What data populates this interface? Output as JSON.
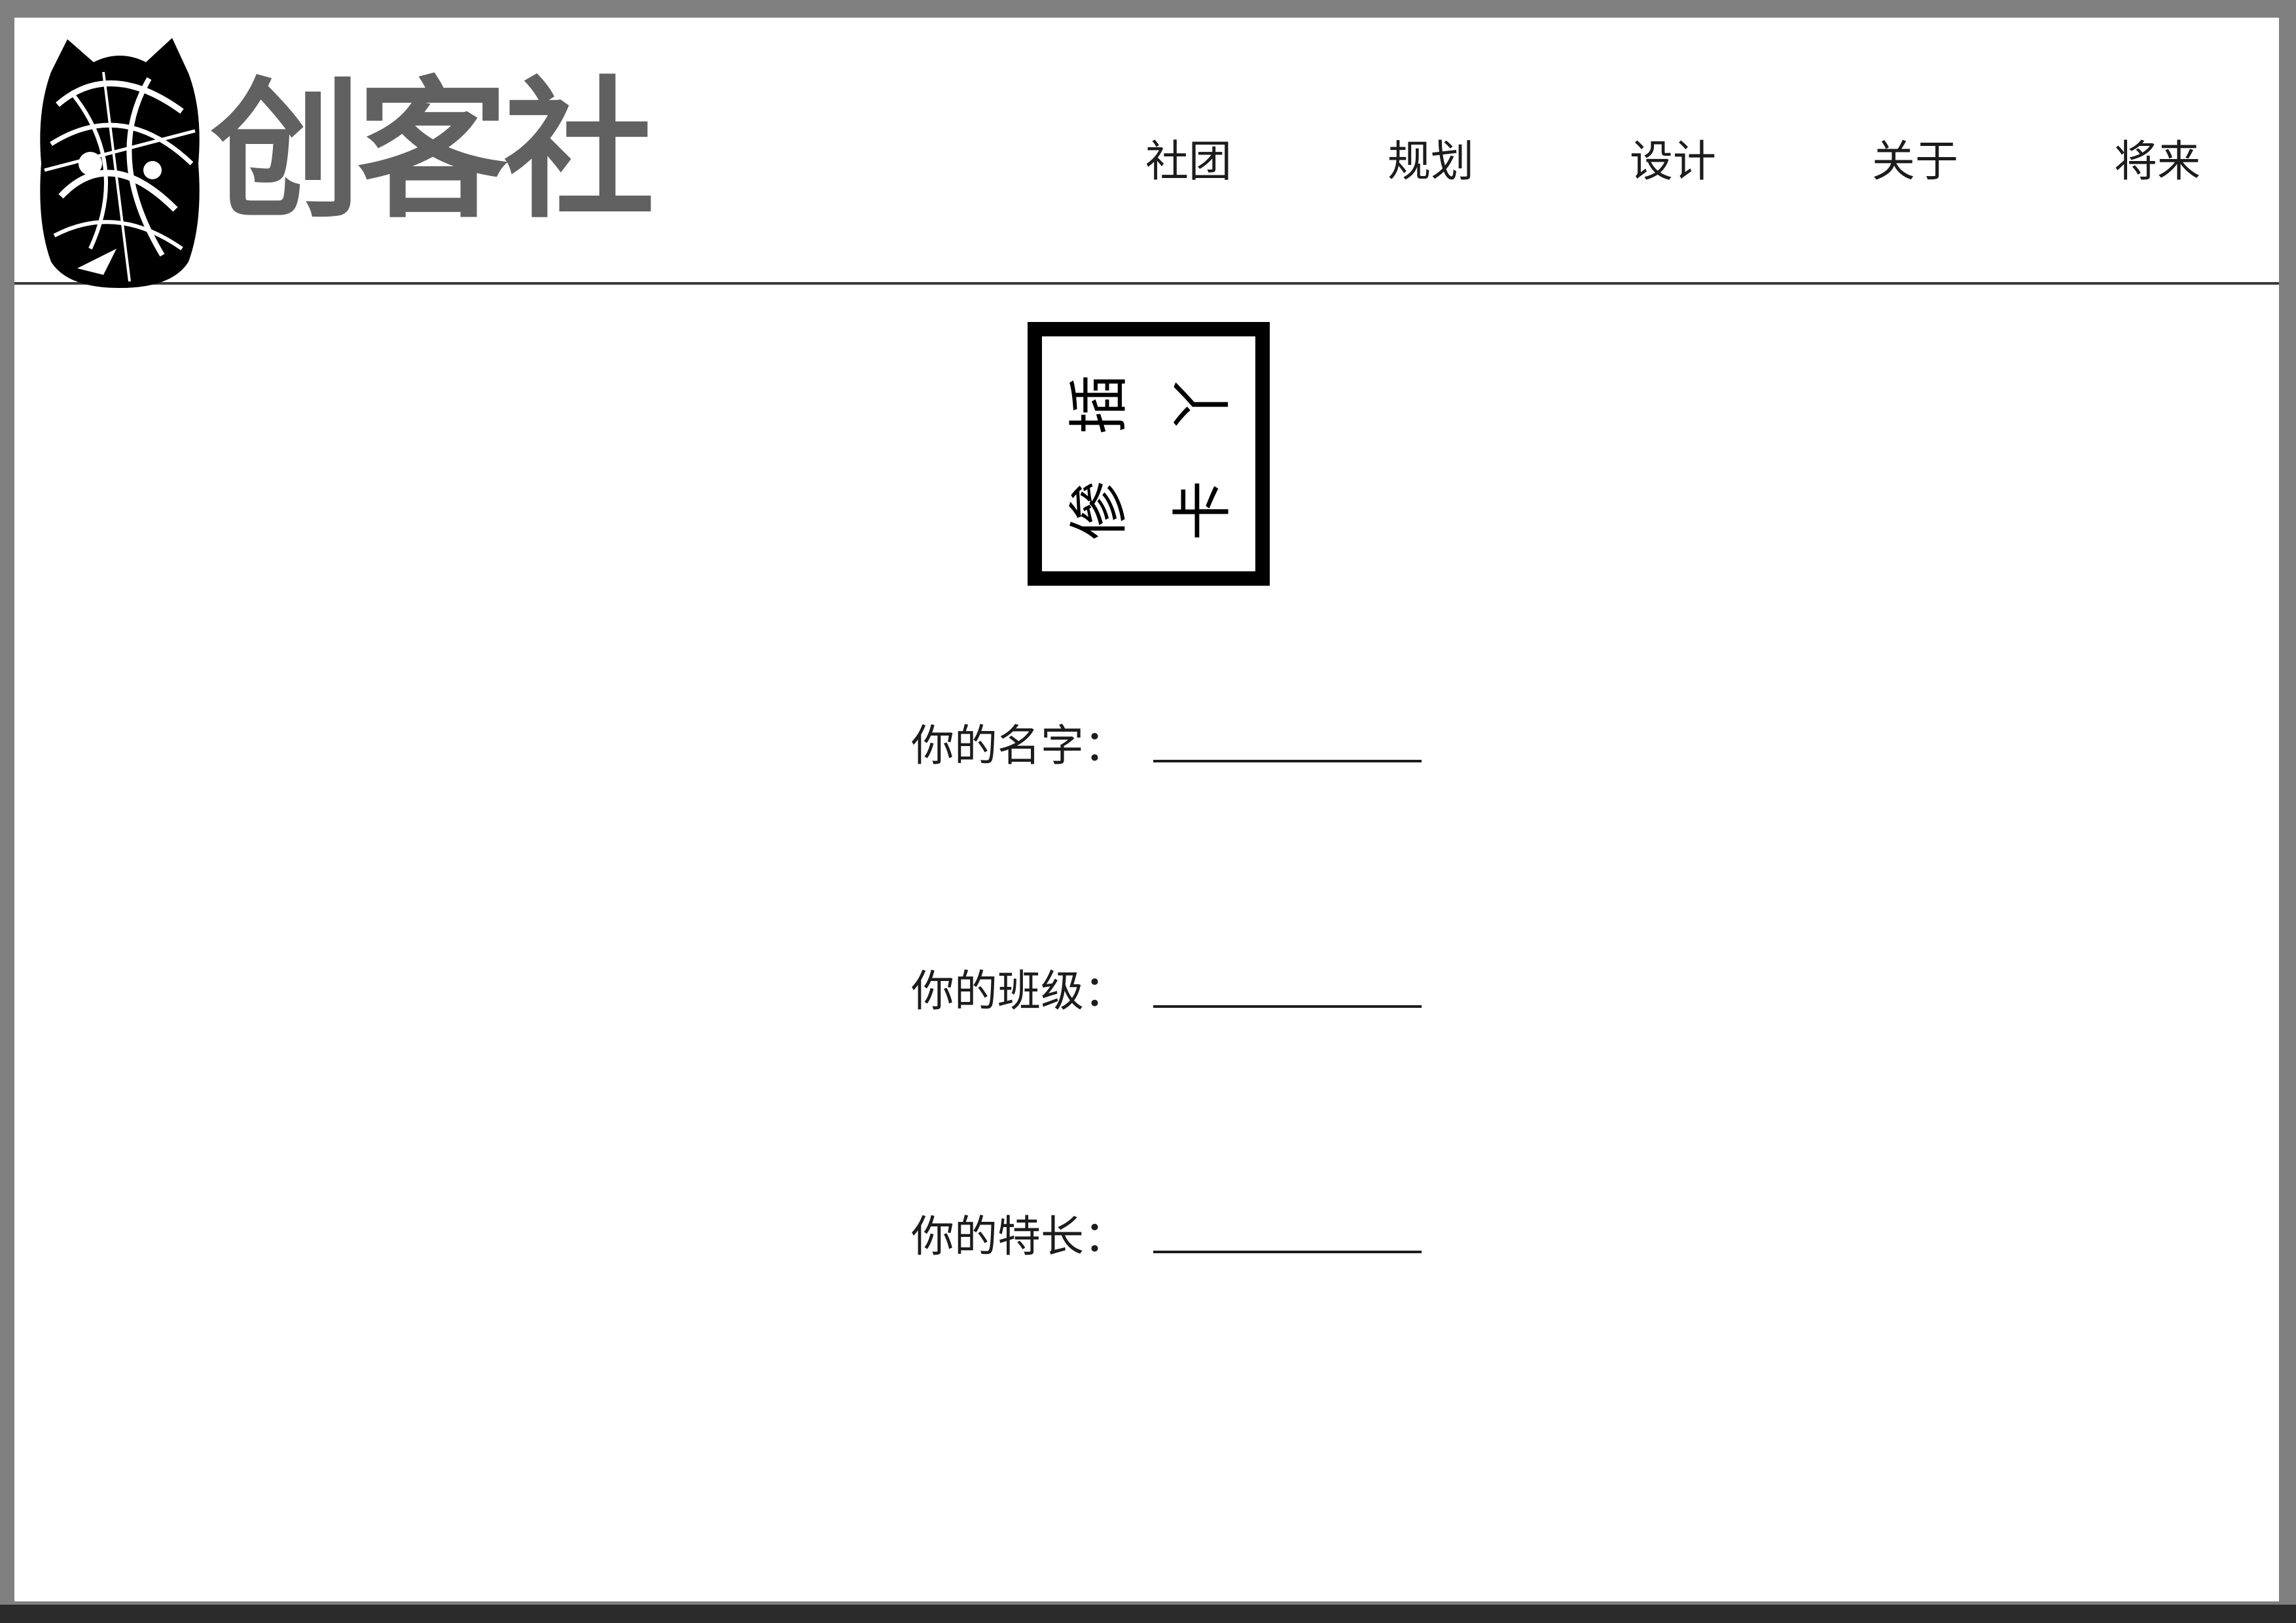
{
  "site": {
    "name": "创客社",
    "logo_icon": "abstract-cat-logo-icon"
  },
  "nav": {
    "items": [
      {
        "label": "社团"
      },
      {
        "label": "规划"
      },
      {
        "label": "设计"
      },
      {
        "label": "关于"
      },
      {
        "label": "将来"
      }
    ]
  },
  "seal": {
    "icon": "square-seal-stamp",
    "text": "个人特长"
  },
  "form": {
    "fields": [
      {
        "label": "你的名字："
      },
      {
        "label": "你的班级："
      },
      {
        "label": "你的特长："
      }
    ]
  },
  "colors": {
    "background": "#ffffff",
    "outer_frame": "#808080",
    "logo_text": "#616161",
    "text": "#1c1c1c"
  }
}
